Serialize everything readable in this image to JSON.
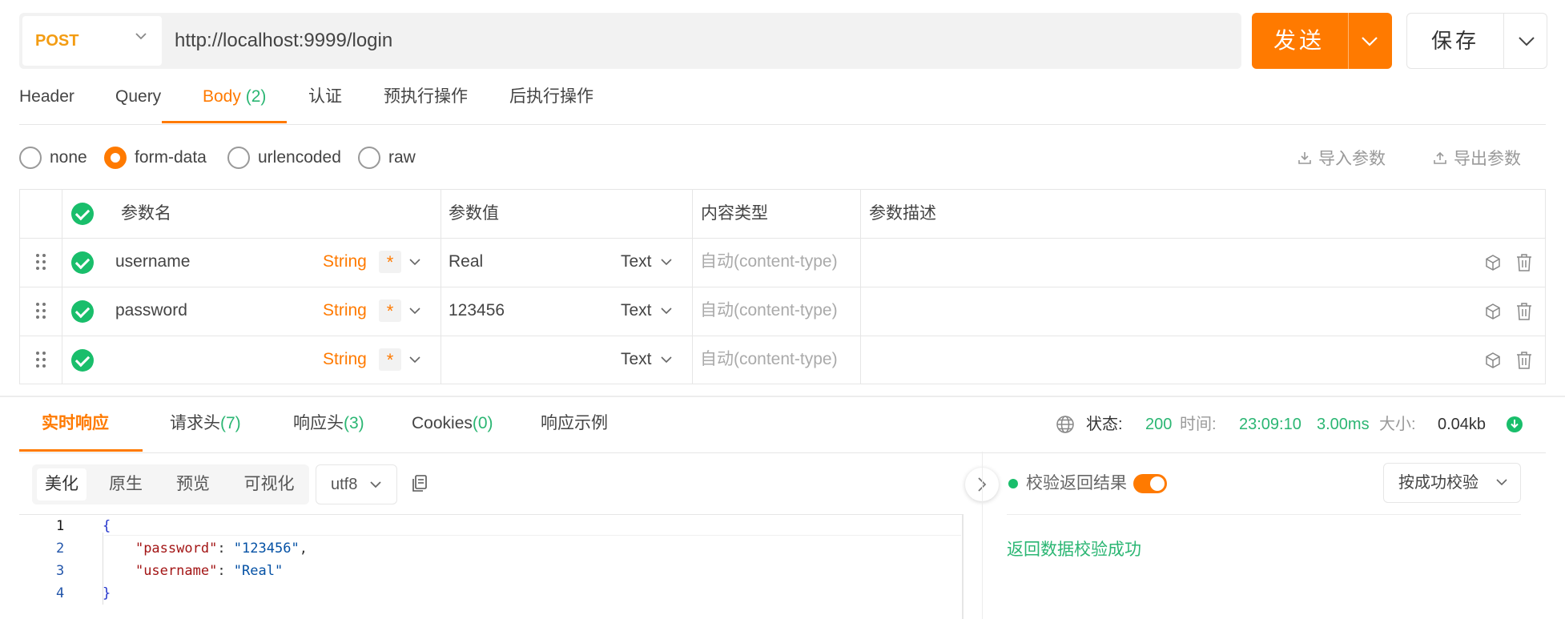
{
  "request": {
    "method": "POST",
    "url": "http://localhost:9999/login",
    "send_label": "发送",
    "save_label": "保存"
  },
  "request_tabs": [
    {
      "label": "Header",
      "count": ""
    },
    {
      "label": "Query",
      "count": ""
    },
    {
      "label": "Body",
      "count": "(2)"
    },
    {
      "label": "认证",
      "count": ""
    },
    {
      "label": "预执行操作",
      "count": ""
    },
    {
      "label": "后执行操作",
      "count": ""
    }
  ],
  "body_types": [
    "none",
    "form-data",
    "urlencoded",
    "raw"
  ],
  "body_type_selected": "form-data",
  "tools": {
    "import": "导入参数",
    "export": "导出参数"
  },
  "params_table": {
    "headers": [
      "参数名",
      "参数值",
      "内容类型",
      "参数描述"
    ],
    "rows": [
      {
        "name": "username",
        "type": "String",
        "required": "*",
        "value": "Real",
        "value_type": "Text",
        "content_type": "自动(content-type)",
        "description": ""
      },
      {
        "name": "password",
        "type": "String",
        "required": "*",
        "value": "123456",
        "value_type": "Text",
        "content_type": "自动(content-type)",
        "description": ""
      },
      {
        "name": "",
        "type": "String",
        "required": "*",
        "value": "",
        "value_type": "Text",
        "content_type": "自动(content-type)",
        "description": ""
      }
    ]
  },
  "response_tabs": [
    {
      "label": "实时响应",
      "count": ""
    },
    {
      "label": "请求头",
      "count": "(7)"
    },
    {
      "label": "响应头",
      "count": "(3)"
    },
    {
      "label": "Cookies",
      "count": "(0)"
    },
    {
      "label": "响应示例",
      "count": ""
    }
  ],
  "status": {
    "status_label": "状态:",
    "status_code": "200",
    "time_label": "时间:",
    "time": "23:09:10",
    "duration": "3.00ms",
    "size_label": "大小:",
    "size": "0.04kb"
  },
  "view_modes": [
    "美化",
    "原生",
    "预览",
    "可视化"
  ],
  "encoding": "utf8",
  "code_lines": [
    {
      "num": "1",
      "text": "{"
    },
    {
      "num": "2",
      "key": "\"password\"",
      "sep": ": ",
      "val": "\"123456\"",
      "tail": ","
    },
    {
      "num": "3",
      "key": "\"username\"",
      "sep": ": ",
      "val": "\"Real\"",
      "tail": ""
    },
    {
      "num": "4",
      "text": "}"
    }
  ],
  "verify": {
    "label": "校验返回结果",
    "enabled": true,
    "mode": "按成功校验",
    "result": "返回数据校验成功"
  },
  "colors": {
    "accent": "#ff7a00",
    "success": "#19be6b",
    "count_green": "#2bb673"
  }
}
